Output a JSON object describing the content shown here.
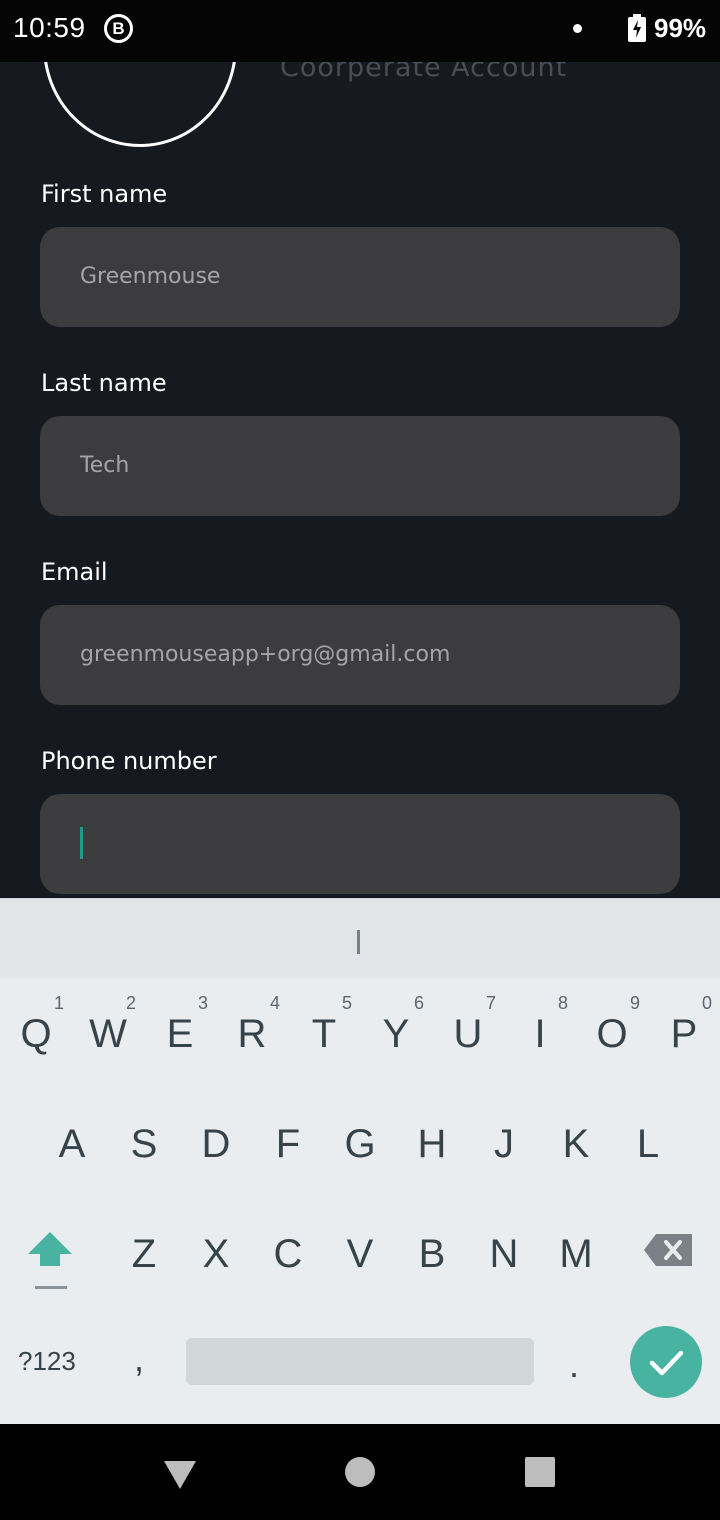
{
  "status_bar": {
    "time": "10:59",
    "notification_icon_letter": "B",
    "battery_percent": "99%"
  },
  "profile": {
    "account_type": "Coorperate Account"
  },
  "form": {
    "fields": [
      {
        "label": "First name",
        "value": "Greenmouse"
      },
      {
        "label": "Last name",
        "value": "Tech"
      },
      {
        "label": "Email",
        "value": "greenmouseapp+org@gmail.com"
      },
      {
        "label": "Phone number",
        "value": ""
      }
    ]
  },
  "keyboard": {
    "row1": [
      {
        "letter": "Q",
        "hint": "1"
      },
      {
        "letter": "W",
        "hint": "2"
      },
      {
        "letter": "E",
        "hint": "3"
      },
      {
        "letter": "R",
        "hint": "4"
      },
      {
        "letter": "T",
        "hint": "5"
      },
      {
        "letter": "Y",
        "hint": "6"
      },
      {
        "letter": "U",
        "hint": "7"
      },
      {
        "letter": "I",
        "hint": "8"
      },
      {
        "letter": "O",
        "hint": "9"
      },
      {
        "letter": "P",
        "hint": "0"
      }
    ],
    "row2": [
      "A",
      "S",
      "D",
      "F",
      "G",
      "H",
      "J",
      "K",
      "L"
    ],
    "row3": [
      "Z",
      "X",
      "C",
      "V",
      "B",
      "N",
      "M"
    ],
    "symbols_label": "?123",
    "comma": ",",
    "period": "."
  },
  "colors": {
    "app_background": "#161920",
    "field_background": "#3c3c3f",
    "accent": "#48b3a1"
  }
}
